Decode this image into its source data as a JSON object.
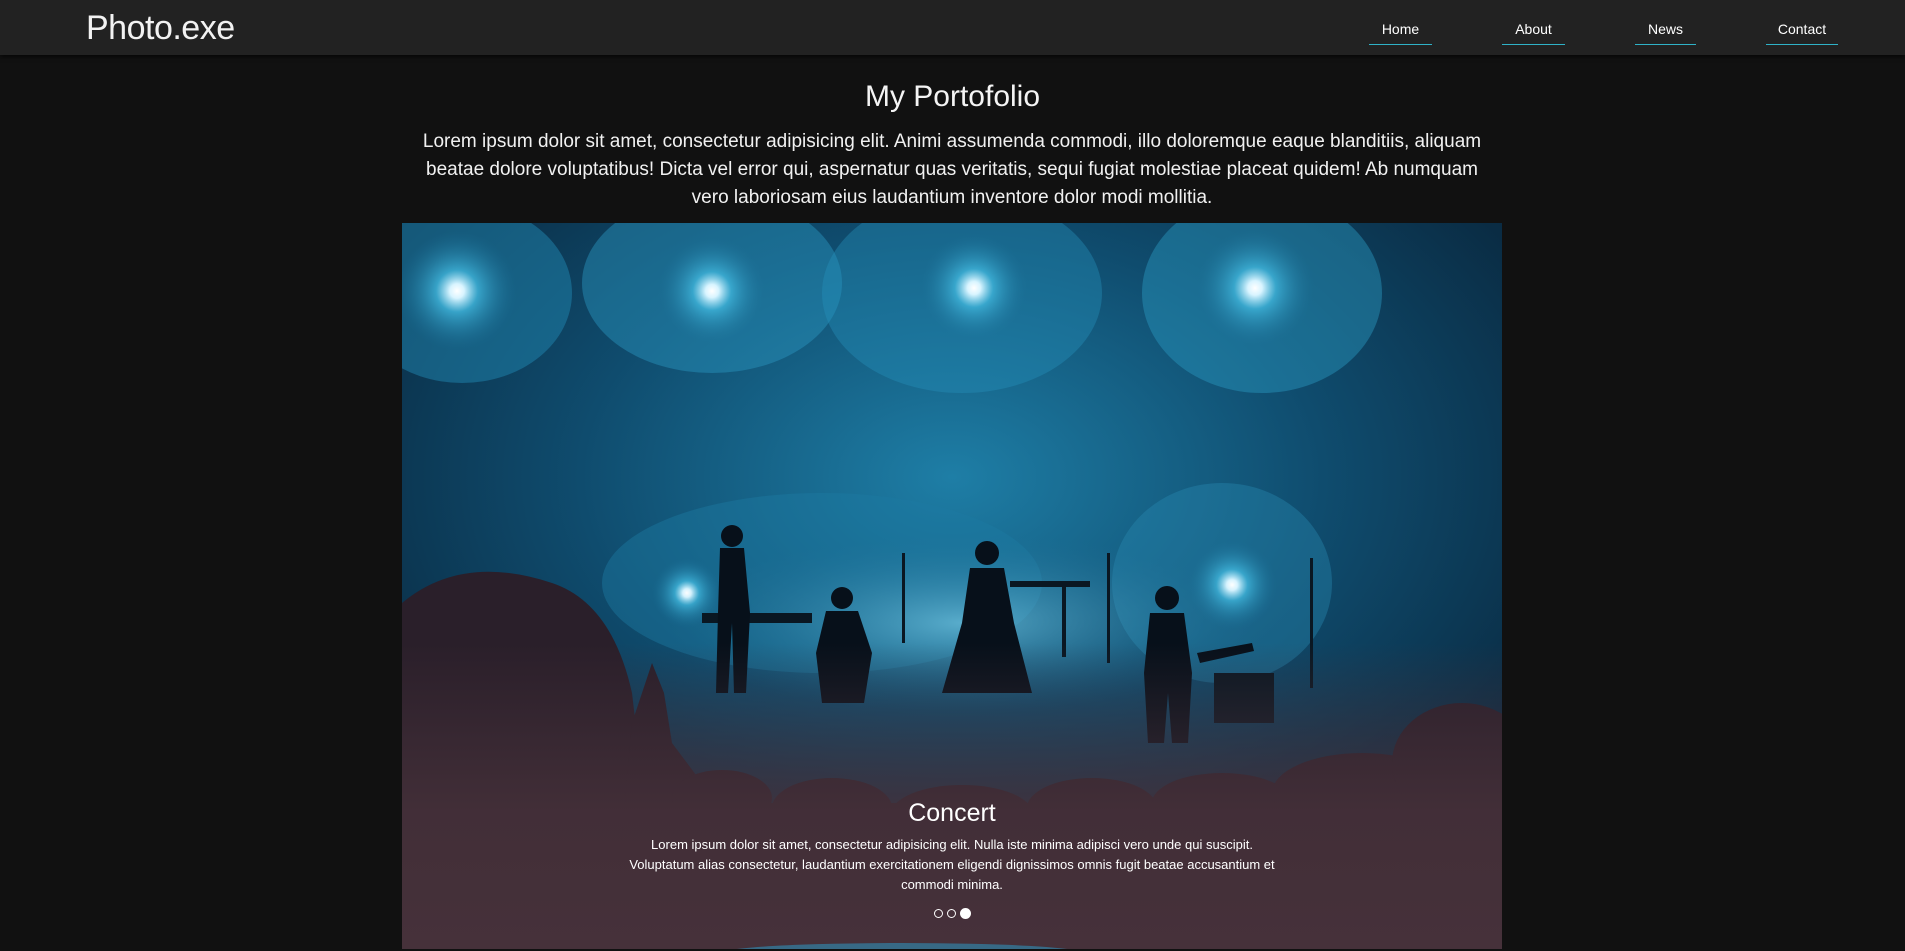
{
  "navbar": {
    "brand": "Photo.exe",
    "links": [
      "Home",
      "About",
      "News",
      "Contact"
    ],
    "accent_color": "#2fb2c7"
  },
  "main": {
    "title": "My Portofolio",
    "intro": "Lorem ipsum dolor sit amet, consectetur adipisicing elit. Animi assumenda commodi, illo doloremque eaque blanditiis, aliquam beatae dolore voluptatibus! Dicta vel error qui, aspernatur quas veritatis, sequi fugiat molestiae placeat quidem! Ab numquam vero laboriosam eius laudantium inventore dolor modi mollitia."
  },
  "carousel": {
    "slide_image": "concert-stage-photo",
    "caption_title": "Concert",
    "caption_text": "Lorem ipsum dolor sit amet, consectetur adipisicing elit. Nulla iste minima adipisci vero unde qui suscipit. Voluptatum alias consectetur, laudantium exercitationem eligendi dignissimos omnis fugit beatae accusantium et commodi minima.",
    "slide_count": 3,
    "active_slide": 3
  }
}
